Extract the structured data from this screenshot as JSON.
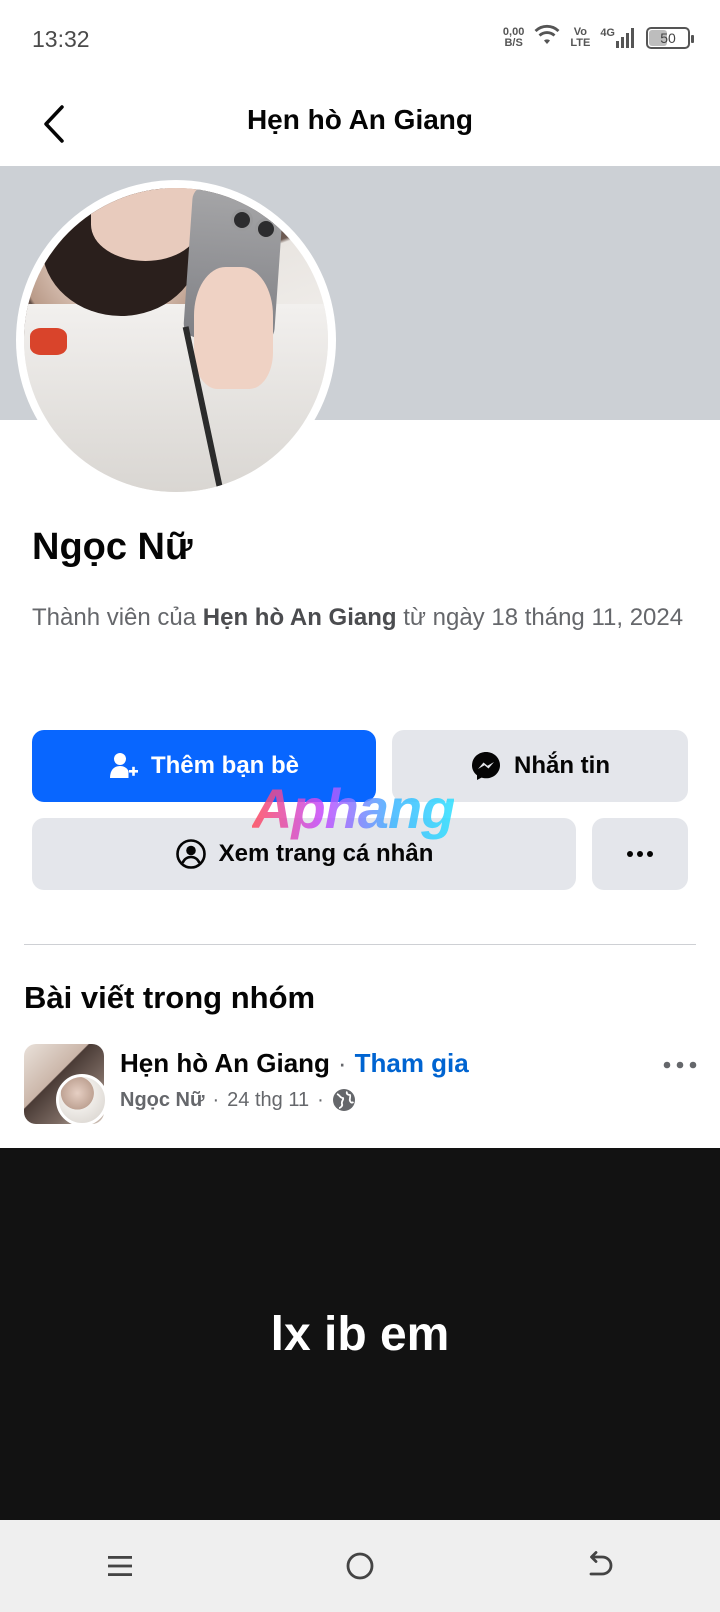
{
  "status_bar": {
    "time": "13:32",
    "net_speed_value": "0,00",
    "net_speed_unit": "B/S",
    "volte_top": "Vo",
    "volte_bottom": "LTE",
    "network": "4G",
    "battery": "50",
    "battery_level": 0.5
  },
  "header": {
    "title": "Hẹn hò An Giang",
    "back_icon": "chevron-left-icon"
  },
  "profile": {
    "name": "Ngọc Nữ",
    "member_prefix": "Thành viên của",
    "member_group": "Hẹn hò An Giang",
    "member_suffix": "từ ngày 18 tháng 11, 2024"
  },
  "actions": {
    "add_friend": "Thêm bạn bè",
    "message": "Nhắn tin",
    "view_profile": "Xem trang cá nhân",
    "more_icon": "more-horizontal-icon"
  },
  "watermark": "Aphang",
  "section": {
    "title": "Bài viết trong nhóm"
  },
  "post": {
    "group_name": "Hẹn hò An Giang",
    "separator": "·",
    "join_label": "Tham gia",
    "author": "Ngọc Nữ",
    "date": "24 thg 11",
    "privacy_icon": "globe-icon",
    "content": "lx ib em"
  },
  "colors": {
    "primary": "#0866ff",
    "secondary_button": "#e4e6eb",
    "link": "#0064d1",
    "cover": "#ccd0d5",
    "post_background": "#121212"
  }
}
